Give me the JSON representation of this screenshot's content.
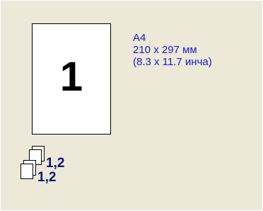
{
  "paper": {
    "page_number": "1",
    "size_name": "A4",
    "size_mm": "210 x 297 мм",
    "size_in": "(8.3 x 11.7 инча)"
  },
  "copies": {
    "top_label": "1,2",
    "bottom_label": "1,2"
  },
  "colors": {
    "panel_background": "#ece9d8",
    "info_text": "#1a1acc",
    "collate_text": "#11117a"
  },
  "icons": {
    "page_preview": "page-preview-icon",
    "collated_copies": "collate-copies-icon"
  }
}
